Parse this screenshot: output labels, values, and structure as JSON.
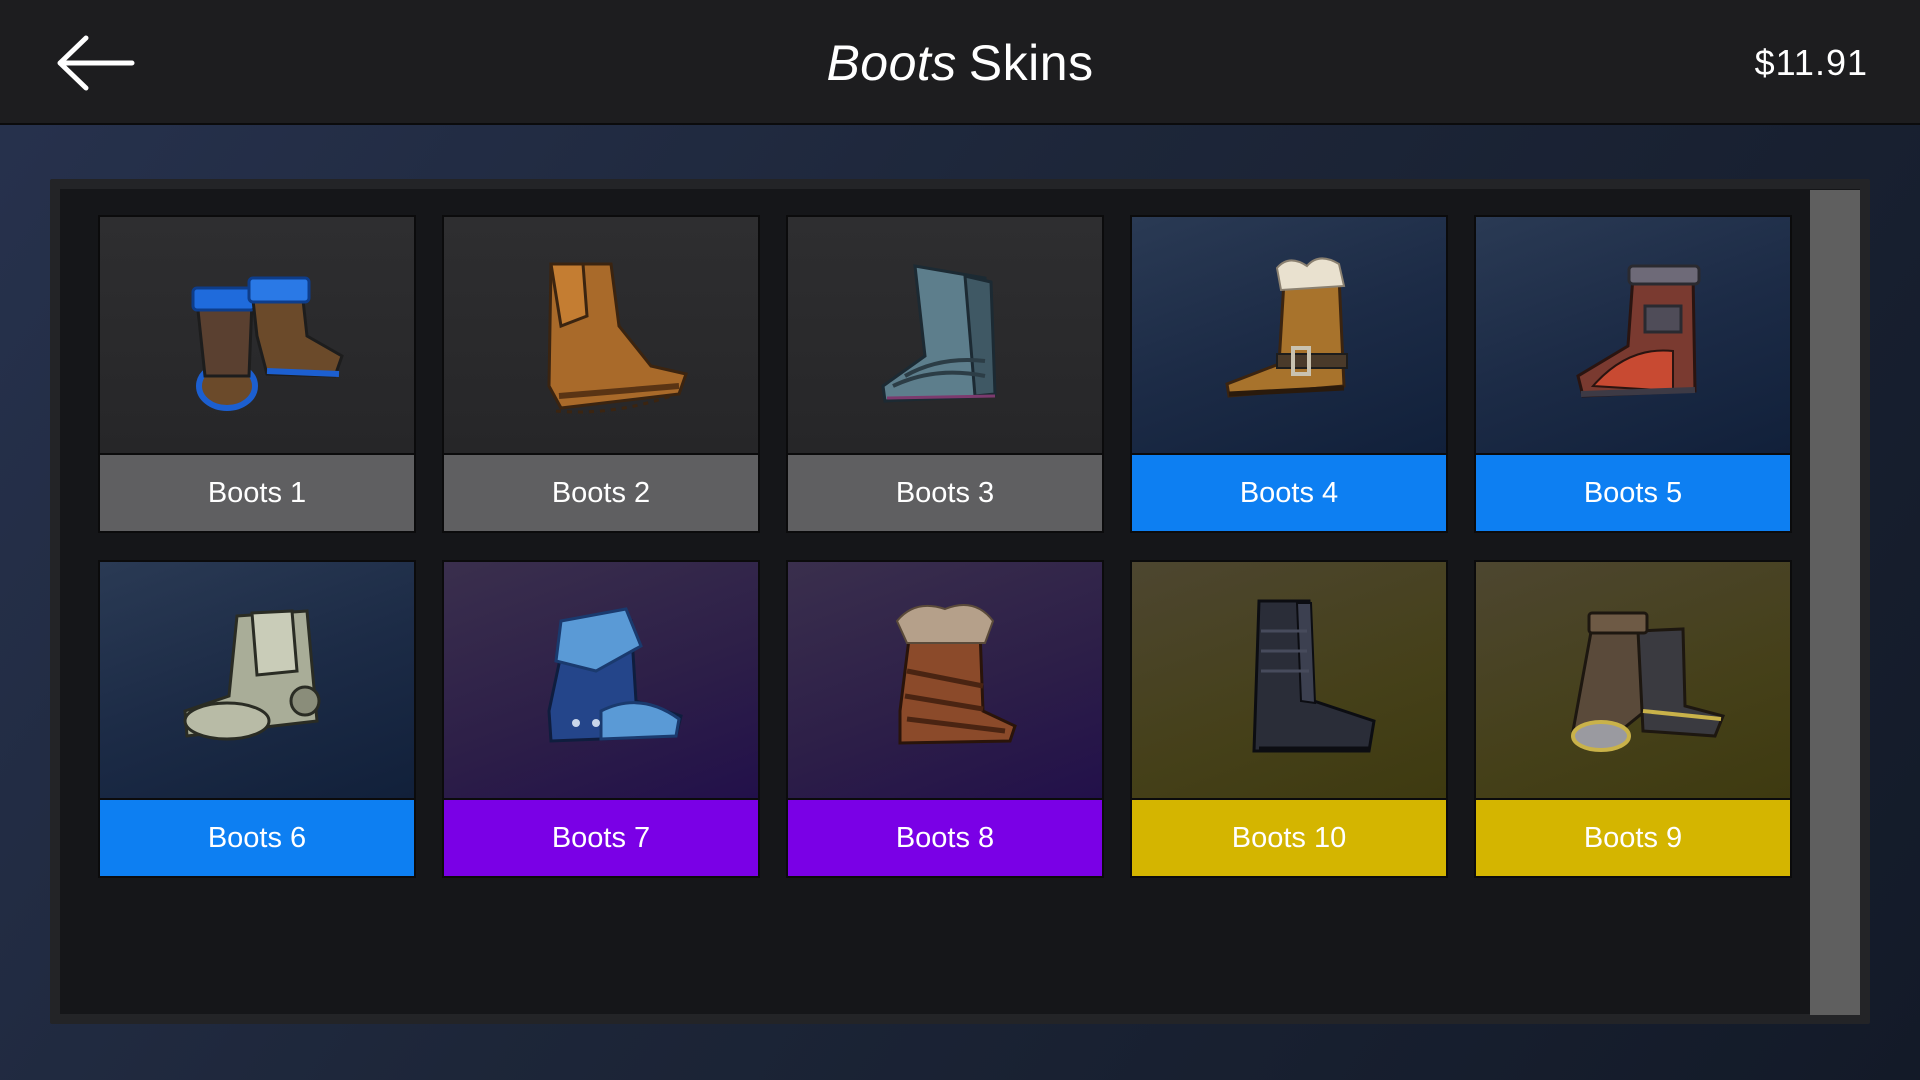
{
  "header": {
    "title_italic": "Boots",
    "title_rest": "Skins",
    "currency": "$11.91"
  },
  "rarity_colors": {
    "common": "#5f5f61",
    "rare": "#0d7ff2",
    "epic": "#7a00e6",
    "legendary": "#d4b500"
  },
  "skins": [
    {
      "label": "Boots 1",
      "rarity": "common",
      "icon": "blue-trim-sandal-boots-icon"
    },
    {
      "label": "Boots 2",
      "rarity": "common",
      "icon": "brown-leather-curled-boot-icon"
    },
    {
      "label": "Boots 3",
      "rarity": "common",
      "icon": "steel-plate-boot-icon"
    },
    {
      "label": "Boots 4",
      "rarity": "rare",
      "icon": "fur-lined-buckle-boot-icon"
    },
    {
      "label": "Boots 5",
      "rarity": "rare",
      "icon": "red-plated-boot-icon"
    },
    {
      "label": "Boots 6",
      "rarity": "rare",
      "icon": "silver-armored-boot-icon"
    },
    {
      "label": "Boots 7",
      "rarity": "epic",
      "icon": "blue-cuffed-boot-icon"
    },
    {
      "label": "Boots 8",
      "rarity": "epic",
      "icon": "fur-strapped-boot-icon"
    },
    {
      "label": "Boots 10",
      "rarity": "legendary",
      "icon": "black-knee-boot-icon"
    },
    {
      "label": "Boots 9",
      "rarity": "legendary",
      "icon": "gold-trim-boots-icon"
    }
  ]
}
